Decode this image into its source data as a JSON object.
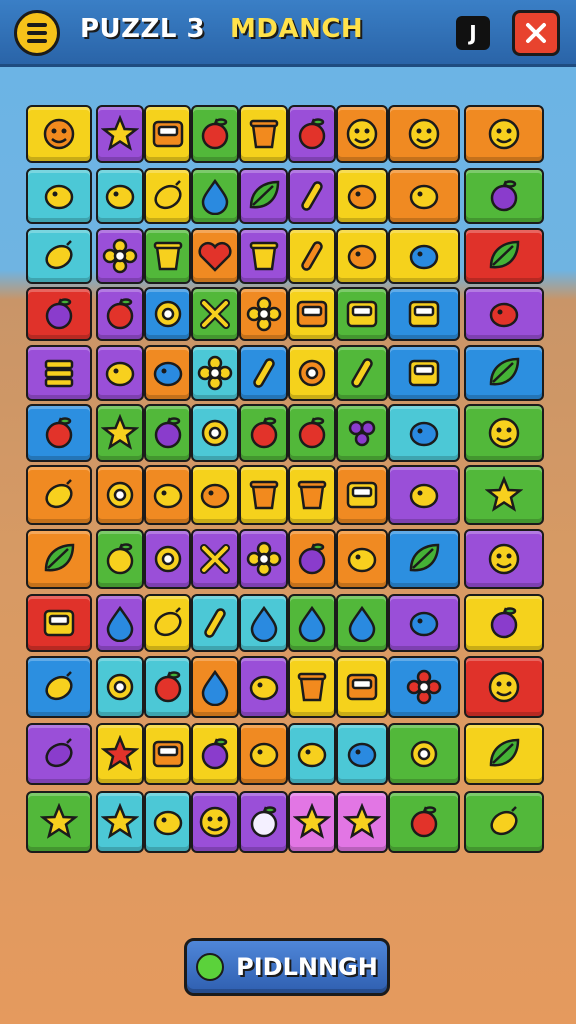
{
  "header": {
    "title_left": "PUZZL 3",
    "title_right": "MDANCH",
    "count": "J"
  },
  "footer": {
    "button_label": "PIDLNNGH"
  },
  "board": {
    "rows": [
      [
        [
          "yellow",
          "monster"
        ],
        [
          "purple",
          "star"
        ],
        [
          "yellow",
          "block"
        ],
        [
          "green",
          "apple"
        ],
        [
          "yellow",
          "bottle"
        ],
        [
          "purple",
          "apple"
        ],
        [
          "orange",
          "face"
        ],
        [
          "orange",
          "cat"
        ],
        [
          "orange",
          "face2"
        ]
      ],
      [
        [
          "teal",
          "flag"
        ],
        [
          "teal",
          "top"
        ],
        [
          "yellow",
          "pear"
        ],
        [
          "green",
          "drop"
        ],
        [
          "purple",
          "leaf"
        ],
        [
          "purple",
          "pen"
        ],
        [
          "yellow",
          "lantern"
        ],
        [
          "orange",
          "fish"
        ],
        [
          "green",
          "plum"
        ]
      ],
      [
        [
          "teal",
          "lemon"
        ],
        [
          "purple",
          "bug"
        ],
        [
          "green",
          "pot"
        ],
        [
          "orange",
          "heart"
        ],
        [
          "purple",
          "cup"
        ],
        [
          "yellow",
          "stick"
        ],
        [
          "yellow",
          "lantern"
        ],
        [
          "yellow",
          "blob"
        ],
        [
          "red",
          "leaf"
        ]
      ],
      [
        [
          "red",
          "berry"
        ],
        [
          "purple",
          "apple"
        ],
        [
          "blue",
          "ring"
        ],
        [
          "green",
          "cross"
        ],
        [
          "orange",
          "flower"
        ],
        [
          "yellow",
          "phone"
        ],
        [
          "green",
          "window"
        ],
        [
          "blue",
          "dice"
        ],
        [
          "purple",
          "balloon"
        ]
      ],
      [
        [
          "purple",
          "stack"
        ],
        [
          "purple",
          "carrot"
        ],
        [
          "orange",
          "blob2"
        ],
        [
          "teal",
          "flower"
        ],
        [
          "blue",
          "pen"
        ],
        [
          "yellow",
          "donut"
        ],
        [
          "green",
          "paddle"
        ],
        [
          "blue",
          "board"
        ],
        [
          "blue",
          "leaf"
        ]
      ],
      [
        [
          "blue",
          "apple"
        ],
        [
          "green",
          "star"
        ],
        [
          "green",
          "plum"
        ],
        [
          "teal",
          "target"
        ],
        [
          "green",
          "apple"
        ],
        [
          "green",
          "apple"
        ],
        [
          "green",
          "grapes"
        ],
        [
          "teal",
          "blob"
        ],
        [
          "green",
          "face3"
        ]
      ],
      [
        [
          "orange",
          "lemon"
        ],
        [
          "orange",
          "ring"
        ],
        [
          "orange",
          "eye"
        ],
        [
          "yellow",
          "dots"
        ],
        [
          "yellow",
          "boot"
        ],
        [
          "yellow",
          "cake"
        ],
        [
          "orange",
          "tray"
        ],
        [
          "purple",
          "shell"
        ],
        [
          "green",
          "sun"
        ]
      ],
      [
        [
          "orange",
          "leaf"
        ],
        [
          "green",
          "apple2"
        ],
        [
          "purple",
          "ring2"
        ],
        [
          "purple",
          "cross2"
        ],
        [
          "purple",
          "bug2"
        ],
        [
          "orange",
          "plum"
        ],
        [
          "orange",
          "clock"
        ],
        [
          "blue",
          "leaf"
        ],
        [
          "purple",
          "virus"
        ]
      ],
      [
        [
          "red",
          "box"
        ],
        [
          "purple",
          "drop"
        ],
        [
          "yellow",
          "pear"
        ],
        [
          "teal",
          "spoon"
        ],
        [
          "teal",
          "drop"
        ],
        [
          "green",
          "drop"
        ],
        [
          "green",
          "drop"
        ],
        [
          "purple",
          "blob"
        ],
        [
          "yellow",
          "plum"
        ]
      ],
      [
        [
          "blue",
          "lemon"
        ],
        [
          "teal",
          "ring"
        ],
        [
          "teal",
          "apple"
        ],
        [
          "orange",
          "drop"
        ],
        [
          "purple",
          "lens"
        ],
        [
          "yellow",
          "teapot"
        ],
        [
          "yellow",
          "box"
        ],
        [
          "blue",
          "splat"
        ],
        [
          "red",
          "face4"
        ]
      ],
      [
        [
          "purple",
          "eggplant"
        ],
        [
          "yellow",
          "sun2"
        ],
        [
          "yellow",
          "radio"
        ],
        [
          "yellow",
          "plum"
        ],
        [
          "orange",
          "robot"
        ],
        [
          "teal",
          "candy"
        ],
        [
          "teal",
          "blob"
        ],
        [
          "green",
          "target2"
        ],
        [
          "yellow",
          "leaf"
        ]
      ],
      [
        [
          "green",
          "star2"
        ],
        [
          "teal",
          "star3"
        ],
        [
          "teal",
          "fish2"
        ],
        [
          "purple",
          "face5"
        ],
        [
          "purple",
          "garlic"
        ],
        [
          "pink",
          "star"
        ],
        [
          "pink",
          "star"
        ],
        [
          "green",
          "apple"
        ],
        [
          "green",
          "lemon"
        ]
      ]
    ]
  },
  "colors": {
    "yellow": "#f5d21c",
    "purple": "#9a4fd8",
    "green": "#52b83a",
    "orange": "#f08a22",
    "teal": "#4cc8d6",
    "red": "#e0322a",
    "blue": "#2c8fe0",
    "pink": "#e276e4",
    "icon_purple": "#8a3ccc",
    "icon_red": "#e2332a",
    "icon_yellow": "#f7d01e",
    "icon_blue": "#2a8ae0",
    "icon_green": "#45b236",
    "icon_orange": "#f28a1e"
  }
}
